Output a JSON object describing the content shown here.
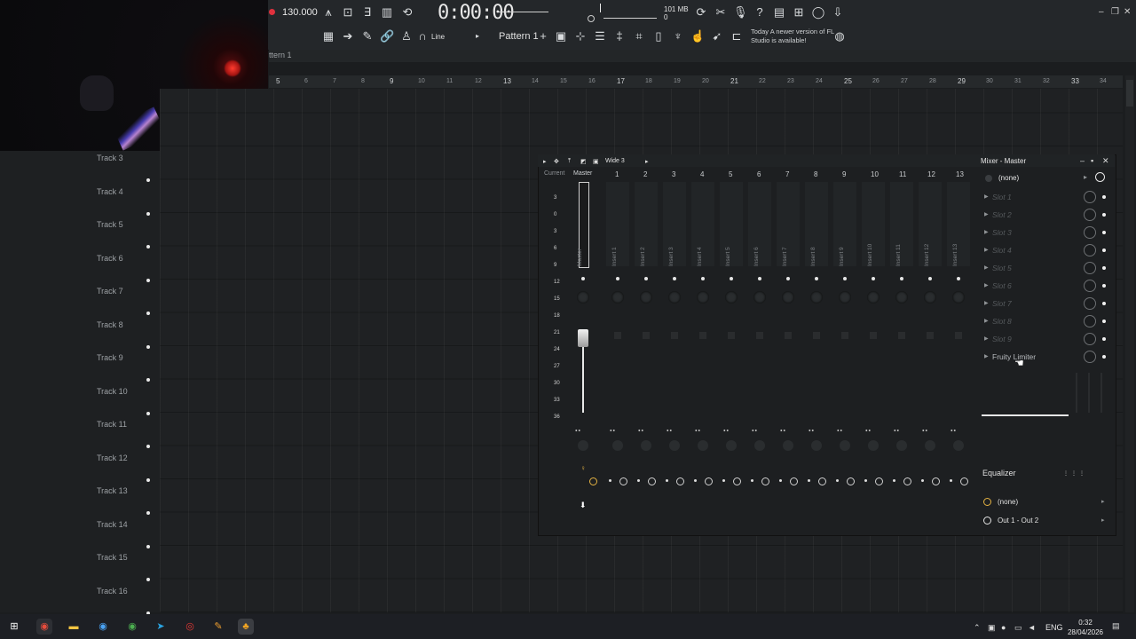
{
  "toolbar": {
    "bpm": "130.000",
    "time": "0:00:00",
    "time_unit": "M:S:CS",
    "memory": "101 MB",
    "memory_sub": "0",
    "pattern": "Pattern 1",
    "draw_mode": "Line",
    "news_today": "Today",
    "news_text": "A newer version of FL Studio is available!"
  },
  "playlist": {
    "title": "ttern 1",
    "ruler": [
      "5",
      "6",
      "7",
      "8",
      "9",
      "10",
      "11",
      "12",
      "13",
      "14",
      "15",
      "16",
      "17",
      "18",
      "19",
      "20",
      "21",
      "22",
      "23",
      "24",
      "25",
      "26",
      "27",
      "28",
      "29",
      "30",
      "31",
      "32",
      "33",
      "34"
    ],
    "tracks": [
      "Track 3",
      "Track 4",
      "Track 5",
      "Track 6",
      "Track 7",
      "Track 8",
      "Track 9",
      "Track 10",
      "Track 11",
      "Track 12",
      "Track 13",
      "Track 14",
      "Track 15",
      "Track 16"
    ]
  },
  "mixer": {
    "layout": "Wide 3",
    "current_label": "Current",
    "master_label": "Master",
    "channel_numbers": [
      "1",
      "2",
      "3",
      "4",
      "5",
      "6",
      "7",
      "8",
      "9",
      "10",
      "11",
      "12",
      "13"
    ],
    "channel_names": [
      "Master",
      "Insert 1",
      "Insert 2",
      "Insert 3",
      "Insert 4",
      "Insert 5",
      "Insert 6",
      "Insert 7",
      "Insert 8",
      "Insert 9",
      "Insert 10",
      "Insert 11",
      "Insert 12",
      "Insert 13"
    ],
    "scale": [
      "3",
      "0",
      "3",
      "6",
      "9",
      "12",
      "15",
      "18",
      "21",
      "24",
      "27",
      "30",
      "33",
      "36"
    ]
  },
  "mixer_master": {
    "title": "Mixer - Master",
    "input": "(none)",
    "slots": [
      "Slot 1",
      "Slot 2",
      "Slot 3",
      "Slot 4",
      "Slot 5",
      "Slot 6",
      "Slot 7",
      "Slot 8",
      "Slot 9",
      "Fruity Limiter"
    ],
    "eq_label": "Equalizer",
    "output_none": "(none)",
    "output": "Out 1 - Out 2"
  },
  "taskbar": {
    "lang": "ENG",
    "time": "0:32",
    "date": "28/04/2026"
  },
  "colors": {
    "accent": "#e0313d",
    "send": "#e5b343"
  }
}
